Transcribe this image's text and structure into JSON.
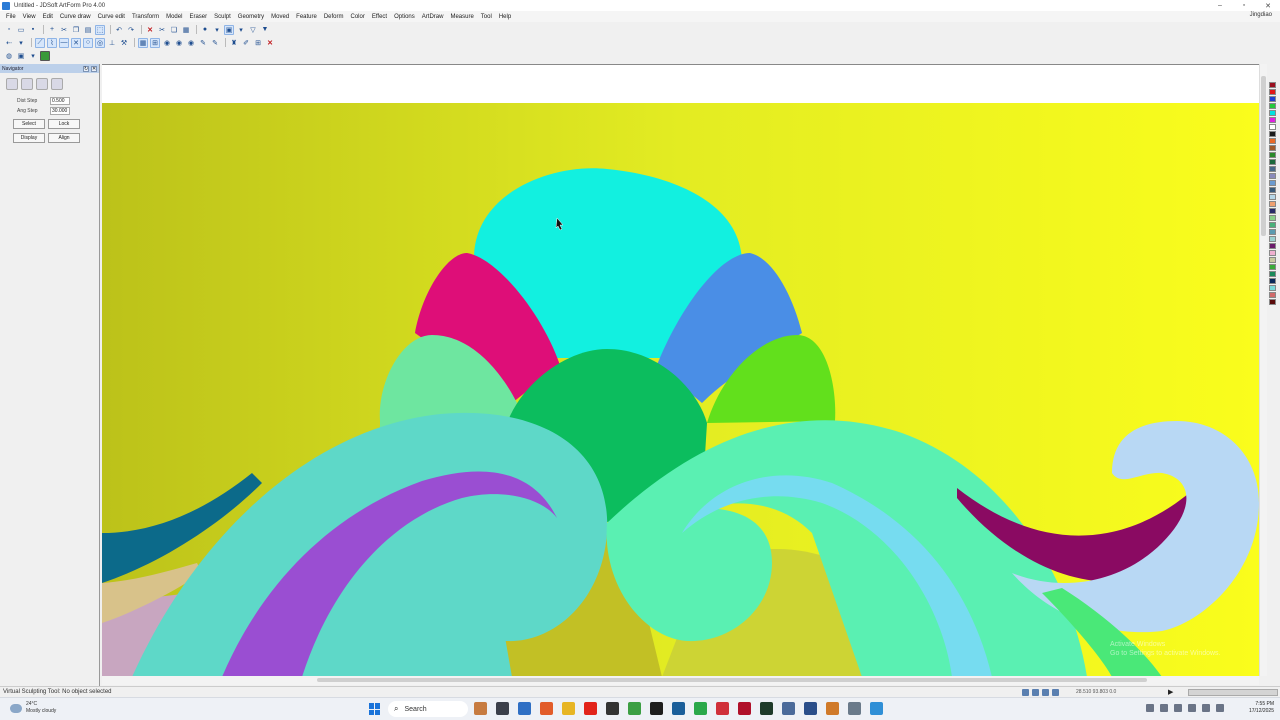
{
  "window": {
    "title": "Untitled - JDSoft ArtForm Pro 4.00",
    "controls": [
      "–",
      "▫",
      "✕"
    ]
  },
  "menu": {
    "items": [
      "File",
      "View",
      "Edit",
      "Curve draw",
      "Curve edit",
      "Transform",
      "Model",
      "Eraser",
      "Sculpt",
      "Geometry",
      "Moved",
      "Feature",
      "Deform",
      "Color",
      "Effect",
      "Options",
      "ArtDraw",
      "Measure",
      "Tool",
      "Help"
    ],
    "user": "Jingdiao"
  },
  "navigator": {
    "title": "Navigator",
    "dist_step_label": "Dist Step",
    "dist_step_value": "0.500",
    "ang_step_label": "Ang Step",
    "ang_step_value": "30.000",
    "select_label": "Select",
    "lock_label": "Lock",
    "display_label": "Display",
    "align_label": "Align"
  },
  "status": {
    "message": "Virtual Sculpting Tool: No object selected",
    "coords": "28.510  93.803  0.0"
  },
  "taskbar": {
    "temperature": "24°C",
    "weather": "Mostly cloudy",
    "search_placeholder": "Search",
    "time": "7:55 PM",
    "date": "17/12/2025"
  },
  "watermark": {
    "line1": "Activate Windows",
    "line2": "Go to Settings to activate Windows."
  },
  "palette_colors": [
    "#9a1020",
    "#e01616",
    "#1f3fd1",
    "#24c83c",
    "#00e0e0",
    "#e020e0",
    "#ffffff",
    "#1a1a1a",
    "#e86a28",
    "#a05a2a",
    "#2a8a2a",
    "#1c6a3c",
    "#4a6a8a",
    "#8a8aba",
    "#6a9acf",
    "#3a5a7a",
    "#b7d7e8",
    "#f0a070",
    "#2a2a6a",
    "#8acf8a",
    "#4ab07a",
    "#5a9ab0",
    "#9acfcf",
    "#6a1a6a",
    "#f0b0d0",
    "#c8c8a0",
    "#3aaa3a",
    "#1a8a5a",
    "#0a2a5a",
    "#7adada",
    "#d06a6a",
    "#5a0a0a"
  ]
}
